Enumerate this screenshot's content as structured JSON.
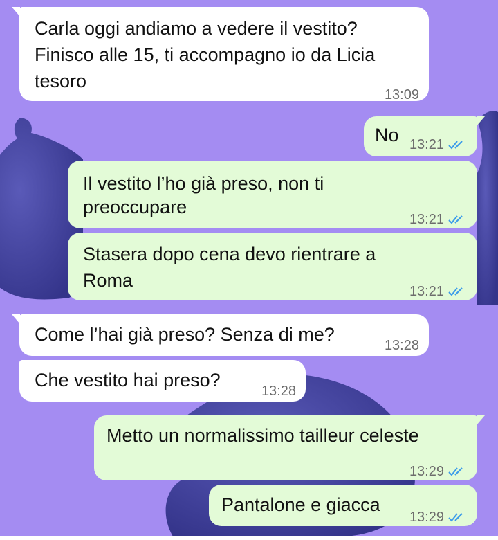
{
  "colors": {
    "wallpaper": "#a48cf2",
    "incoming_bubble": "#ffffff",
    "outgoing_bubble": "#e3fbd7",
    "read_ticks": "#3b9bea",
    "fig": "#4a4aa6"
  },
  "messages": [
    {
      "direction": "in",
      "lines": [
        "Carla oggi andiamo a vedere il vestito?",
        "Finisco alle 15, ti accompagno io da Licia",
        "tesoro"
      ],
      "time": "13:09"
    },
    {
      "direction": "out",
      "lines": [
        "No"
      ],
      "time": "13:21",
      "read_icon": "double-check-icon"
    },
    {
      "direction": "out",
      "lines": [
        "Il vestito l’ho già preso, non ti",
        "preoccupare"
      ],
      "time": "13:21",
      "read_icon": "double-check-icon"
    },
    {
      "direction": "out",
      "lines": [
        "Stasera dopo cena devo rientrare a",
        "Roma"
      ],
      "time": "13:21",
      "read_icon": "double-check-icon"
    },
    {
      "direction": "in",
      "lines": [
        "Come l’hai già preso? Senza di me?"
      ],
      "time": "13:28"
    },
    {
      "direction": "in",
      "lines": [
        "Che vestito hai preso?"
      ],
      "time": "13:28"
    },
    {
      "direction": "out",
      "lines": [
        "Metto un normalissimo tailleur celeste"
      ],
      "time": "13:29",
      "read_icon": "double-check-icon"
    },
    {
      "direction": "out",
      "lines": [
        "Pantalone e giacca"
      ],
      "time": "13:29",
      "read_icon": "double-check-icon"
    }
  ]
}
